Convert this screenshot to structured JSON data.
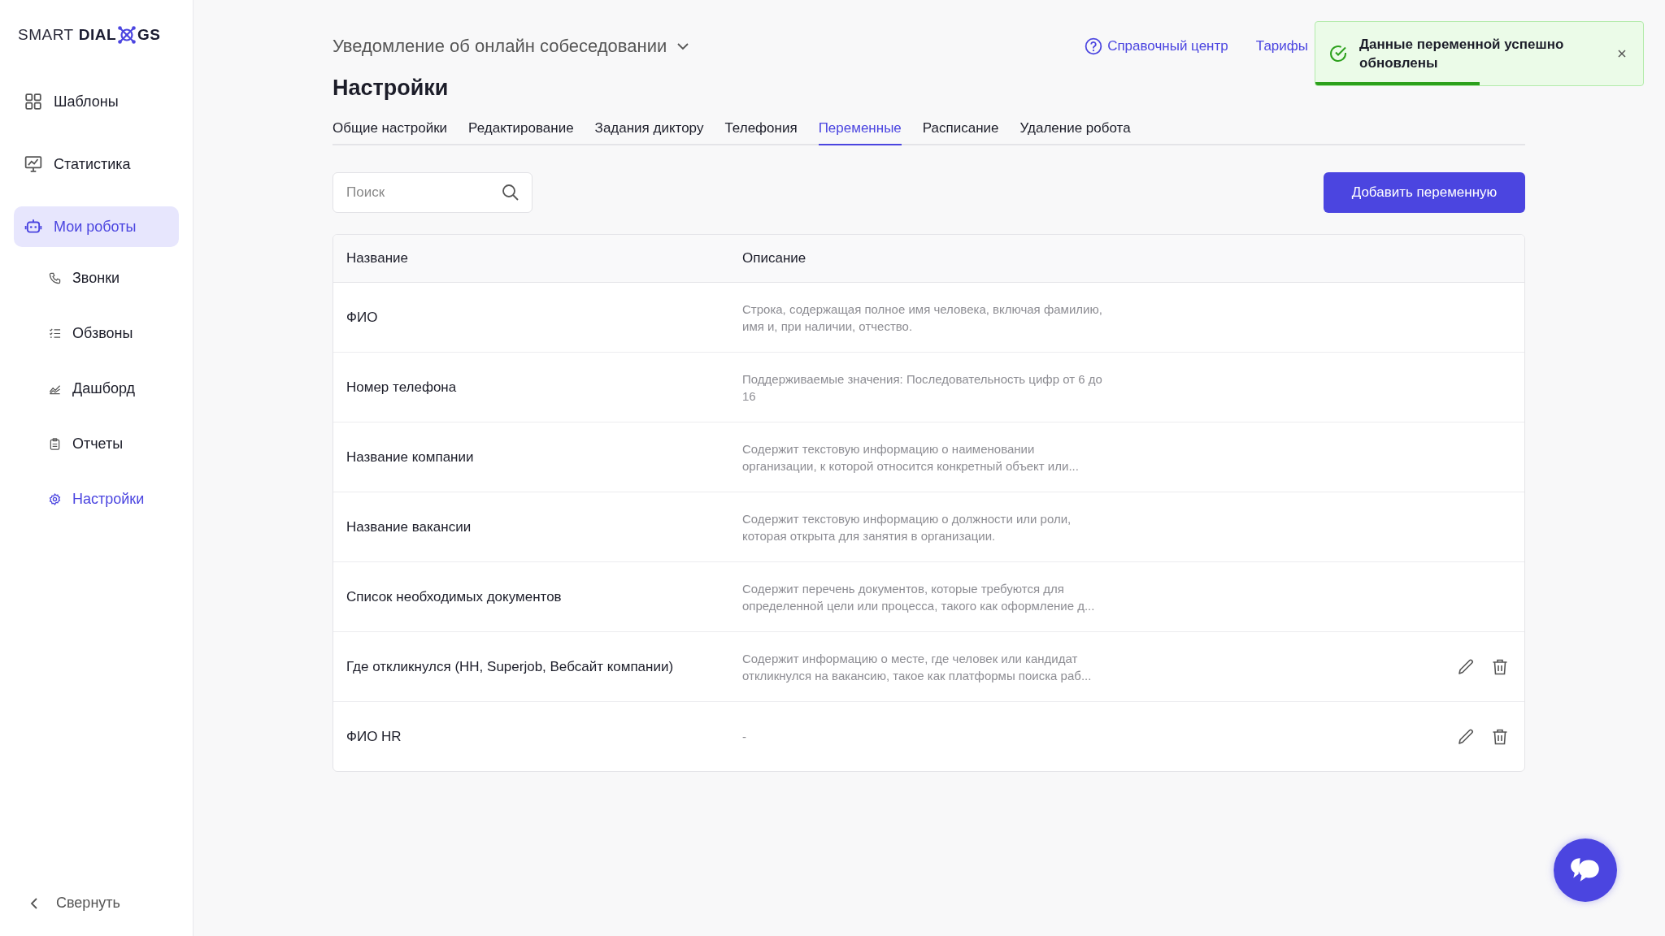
{
  "sidebar": {
    "logo": {
      "light": "SMART",
      "bold": "DIAL",
      "tail": "GS"
    },
    "items": [
      {
        "label": "Шаблоны",
        "selected": false
      },
      {
        "label": "Статистика",
        "selected": false
      },
      {
        "label": "Мои роботы",
        "selected": true,
        "children": [
          {
            "label": "Звонки",
            "selected": false
          },
          {
            "label": "Обзвоны",
            "selected": false
          },
          {
            "label": "Дашборд",
            "selected": false
          },
          {
            "label": "Отчеты",
            "selected": false
          },
          {
            "label": "Настройки",
            "selected": true
          }
        ]
      }
    ],
    "collapse": "Свернуть"
  },
  "header": {
    "robot_name": "Уведомление об онлайн собеседовании",
    "help": "Справочный центр",
    "pricing": "Тарифы"
  },
  "toast": {
    "message": "Данные переменной успешно обновлены",
    "level": 0.5
  },
  "title": "Настройки",
  "tabs": [
    {
      "label": "Общие настройки",
      "selected": false
    },
    {
      "label": "Редактирование",
      "selected": false
    },
    {
      "label": "Задания диктору",
      "selected": false
    },
    {
      "label": "Телефония",
      "selected": false
    },
    {
      "label": "Переменные",
      "selected": true
    },
    {
      "label": "Расписание",
      "selected": false
    },
    {
      "label": "Удаление робота",
      "selected": false
    }
  ],
  "search": {
    "placeholder": "Поиск"
  },
  "add_button": "Добавить переменную",
  "table": {
    "columns": [
      "Название",
      "Описание"
    ],
    "rows": [
      {
        "name": "ФИО",
        "description": "Строка, содержащая полное имя человека, включая фамилию, имя и, при наличии, отчество.",
        "actions": false
      },
      {
        "name": "Номер телефона",
        "description": "Поддерживаемые значения: Последовательность цифр от 6 до 16",
        "actions": false
      },
      {
        "name": "Название компании",
        "description": "Содержит текстовую информацию о наименовании организации, к которой относится конкретный объект или...",
        "actions": false
      },
      {
        "name": "Название вакансии",
        "description": "Содержит текстовую информацию о должности или роли, которая открыта для занятия в организации.",
        "actions": false
      },
      {
        "name": "Список необходимых документов",
        "description": "Содержит перечень документов, которые требуются для определенной цели или процесса, такого как оформление д...",
        "actions": false
      },
      {
        "name": "Где откликнулся (HH, Superjob, Вебсайт компании)",
        "description": "Содержит информацию о месте, где человек или кандидат откликнулся на вакансию, такое как платформы поиска раб...",
        "actions": true
      },
      {
        "name": "ФИО HR",
        "description": "-",
        "actions": true
      }
    ]
  }
}
